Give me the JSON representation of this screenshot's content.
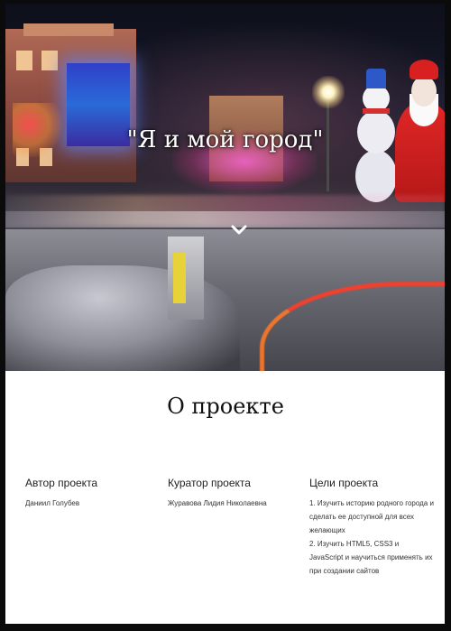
{
  "hero": {
    "title": "\"Я и мой город\"",
    "scroll_icon": "chevron-down-icon"
  },
  "about": {
    "heading": "О проекте",
    "author": {
      "label": "Автор проекта",
      "value": "Даниил Голубев"
    },
    "curator": {
      "label": "Куратор проекта",
      "value": "Журавова Лидия Николаевна"
    },
    "goals": {
      "label": "Цели проекта",
      "items": [
        "1. Изучить историю родного города и сделать ее доступной для всех желающих",
        "2. Изучить HTML5, CSS3 и JavaScript и научиться применять их при создании сайтов"
      ]
    }
  }
}
